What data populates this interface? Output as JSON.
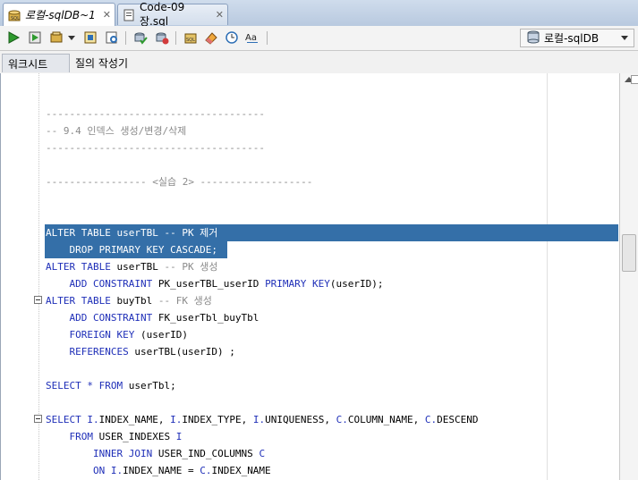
{
  "tabs": [
    {
      "label": "로컬-sqlDB~1",
      "active": true,
      "icon": "sql-worksheet-icon"
    },
    {
      "label": "Code-09장.sql",
      "active": false,
      "icon": "sql-file-icon"
    }
  ],
  "toolbar": {
    "connection": "로컬-sqlDB"
  },
  "subtabs": {
    "worksheet": "워크시트",
    "query_builder": "질의 작성기"
  },
  "code": {
    "l1": "-------------------------------------",
    "l2": "-- 9.4 인덱스 생성/변경/삭제",
    "l3": "-------------------------------------",
    "l4": "----------------- <실습 2> -------------------",
    "l5a": "ALTER TABLE userTBL -- PK 제거",
    "l5b": "    DROP PRIMARY KEY CASCADE;",
    "l6a_kw1": "ALTER TABLE",
    "l6a_txt": " userTBL ",
    "l6a_cmt": "-- PK 생성",
    "l6b_kw1": "    ADD CONSTRAINT",
    "l6b_txt": " PK_userTBL_userID ",
    "l6b_kw2": "PRIMARY KEY",
    "l6b_txt2": "(userID);",
    "l7a_kw1": "ALTER TABLE",
    "l7a_txt": " buyTbl ",
    "l7a_cmt": "-- FK 생성",
    "l7b_kw1": "    ADD CONSTRAINT",
    "l7b_txt": " FK_userTbl_buyTbl",
    "l7c_kw1": "    FOREIGN KEY",
    "l7c_txt": " (userID)",
    "l7d_kw1": "    REFERENCES",
    "l7d_txt": " userTBL(userID) ;",
    "l8_kw1": "SELECT",
    "l8_kw2": " * ",
    "l8_kw3": "FROM",
    "l8_txt": " userTbl;",
    "l9_kw1": "SELECT",
    "l9_a": " I.",
    "l9_b": "INDEX_NAME, ",
    "l9_c": "I.",
    "l9_d": "INDEX_TYPE, ",
    "l9_e": "I.",
    "l9_f": "UNIQUENESS, ",
    "l9_g": "C.",
    "l9_h": "COLUMN_NAME, ",
    "l9_i": "C.",
    "l9_j": "DESCEND",
    "l10_kw": "    FROM",
    "l10_txt": " USER_INDEXES ",
    "l10_alias": "I",
    "l11_kw": "        INNER JOIN",
    "l11_txt": " USER_IND_COLUMNS ",
    "l11_alias": "C",
    "l12_kw": "        ON",
    "l12_a": " I.",
    "l12_b": "INDEX_NAME = ",
    "l12_c": "C.",
    "l12_d": "INDEX_NAME"
  },
  "colors": {
    "keyword": "#1f2fb8",
    "comment": "#8a8a8a",
    "selection": "#346fa8"
  }
}
